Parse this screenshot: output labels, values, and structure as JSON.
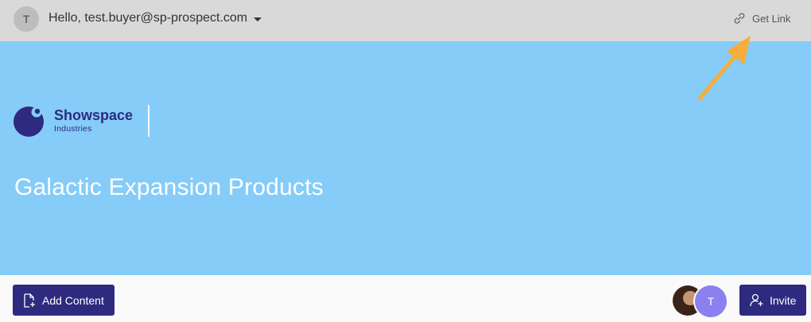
{
  "header": {
    "avatar_initial": "T",
    "greeting": "Hello, test.buyer@sp-prospect.com",
    "get_link_label": "Get Link"
  },
  "hero": {
    "brand_name": "Showspace",
    "brand_sub": "Industries",
    "title": "Galactic Expansion Products",
    "background_color": "#85ccf8"
  },
  "footer": {
    "add_content_label": "Add Content",
    "invite_label": "Invite",
    "member_initial": "T"
  },
  "colors": {
    "brand": "#2e2a7f",
    "topbar": "#d9d9d9",
    "annotation_arrow": "#f6ad3b"
  },
  "icons": [
    "link-icon",
    "chevron-down-icon",
    "add-file-icon",
    "add-user-icon",
    "annotation-arrow"
  ]
}
